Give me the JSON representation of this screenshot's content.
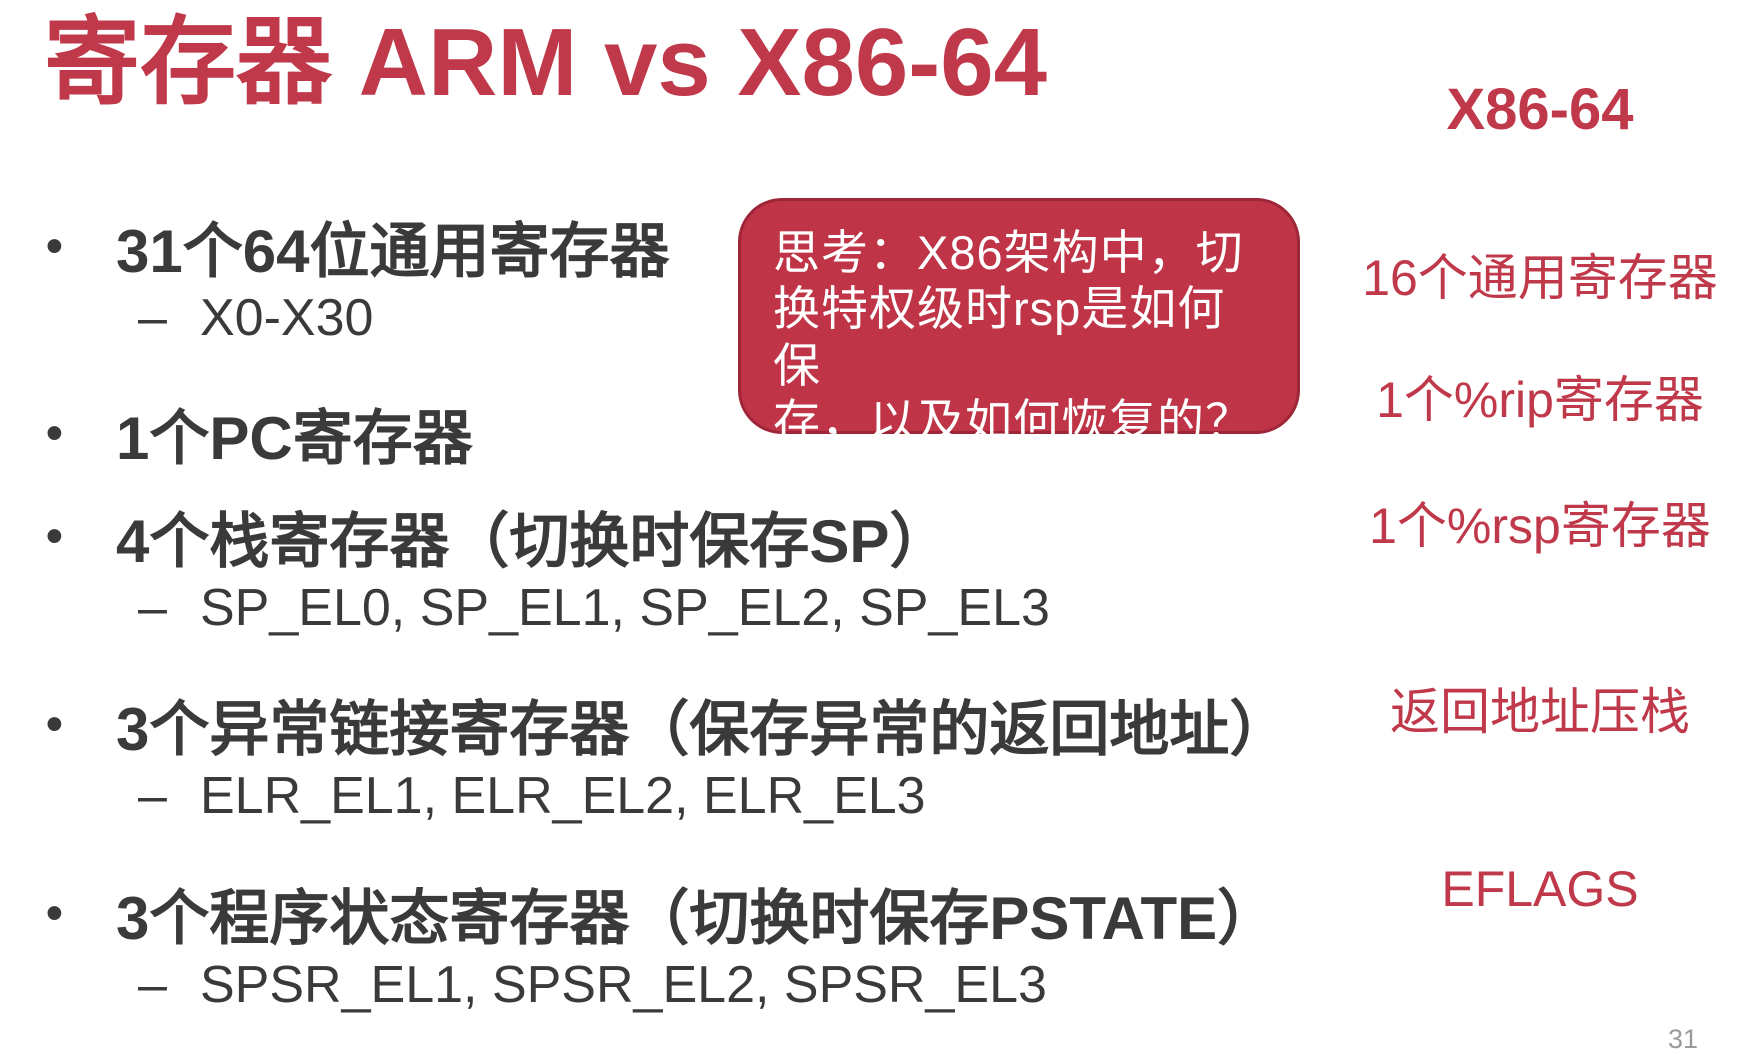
{
  "title": "寄存器 ARM vs X86-64",
  "bullets": [
    {
      "label": "31个64位通用寄存器",
      "sub": "X0-X30"
    },
    {
      "label": "1个PC寄存器",
      "sub": ""
    },
    {
      "label": "4个栈寄存器（切换时保存SP）",
      "sub": "SP_EL0, SP_EL1, SP_EL2, SP_EL3"
    },
    {
      "label": "3个异常链接寄存器（保存异常的返回地址）",
      "sub": "ELR_EL1, ELR_EL2, ELR_EL3"
    },
    {
      "label": "3个程序状态寄存器（切换时保存PSTATE）",
      "sub": "SPSR_EL1, SPSR_EL2, SPSR_EL3"
    }
  ],
  "bullet_marker": "•",
  "sub_marker": "–",
  "callout": {
    "lines": [
      "思考：X86架构中，切",
      "换特权级时rsp是如何保",
      "存，以及如何恢复的？"
    ]
  },
  "x86": {
    "header": "X86-64",
    "notes": [
      "16个通用寄存器",
      "1个%rip寄存器",
      "1个%rsp寄存器",
      "返回地址压栈",
      "EFLAGS"
    ]
  },
  "page_number": "31",
  "colors": {
    "accent": "#c0394b",
    "callout_fill": "#bf3547",
    "text": "#3a3a3a",
    "page_number": "#9a9a9a"
  }
}
